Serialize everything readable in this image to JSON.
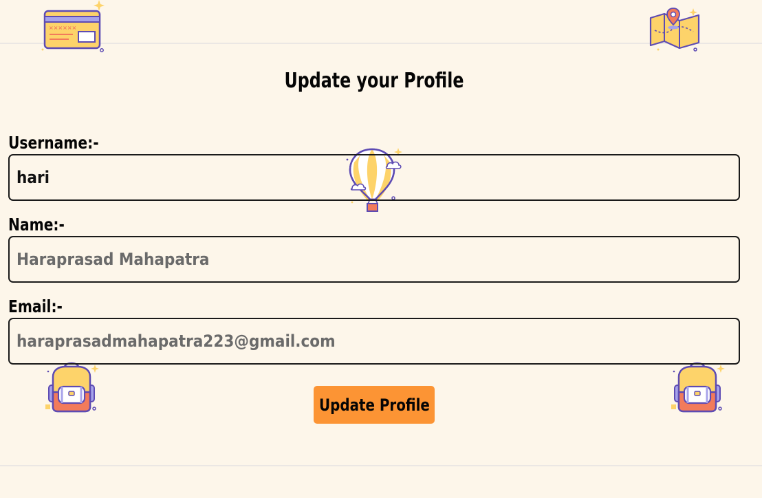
{
  "header": {
    "title": "Update your Profile"
  },
  "form": {
    "username": {
      "label": "Username:-",
      "value": "hari"
    },
    "name": {
      "label": "Name:-",
      "value": "Haraprasad Mahapatra"
    },
    "email": {
      "label": "Email:-",
      "value": "haraprasadmahapatra223@gmail.com"
    },
    "submit_label": "Update Profile"
  },
  "icons": [
    "credit-card-icon",
    "map-icon",
    "hot-air-balloon-icon",
    "backpack-icon",
    "backpack-icon"
  ],
  "colors": {
    "background": "#fdf6ea",
    "button": "#fc9434",
    "icon_yellow": "#fdd36a",
    "icon_purple": "#5d4bb3",
    "icon_orange": "#f27b5b",
    "icon_lavender": "#a7a3ea"
  }
}
